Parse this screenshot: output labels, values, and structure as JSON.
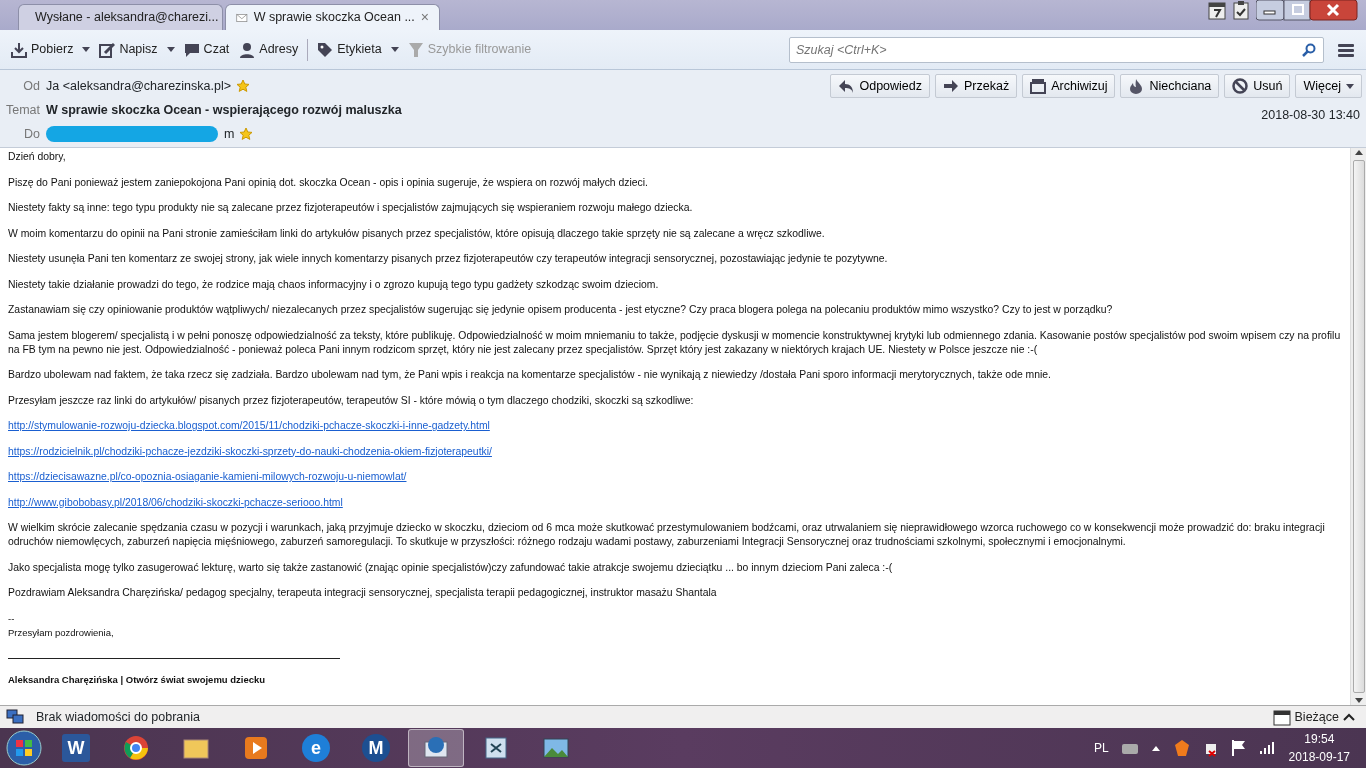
{
  "tabs": [
    {
      "kind": "folder",
      "label": "Wysłane - aleksandra@charezi...",
      "selected": false
    },
    {
      "kind": "message",
      "label": "W sprawie skoczka Ocean ...",
      "selected": true,
      "close": "×"
    }
  ],
  "toolbar": {
    "buttons": [
      {
        "kind": "download",
        "label": "Pobierz",
        "dropdown": true,
        "disabled": false
      },
      {
        "kind": "write",
        "label": "Napisz",
        "dropdown": true,
        "disabled": false
      },
      {
        "kind": "chat",
        "label": "Czat",
        "dropdown": false,
        "disabled": false
      },
      {
        "kind": "contacts",
        "label": "Adresy",
        "dropdown": false,
        "disabled": false
      },
      {
        "kind": "tag",
        "label": "Etykieta",
        "dropdown": true,
        "disabled": false
      },
      {
        "kind": "filter",
        "label": "Szybkie filtrowanie",
        "dropdown": false,
        "disabled": true
      }
    ],
    "search": {
      "placeholder": "Szukaj <Ctrl+K>"
    }
  },
  "header": {
    "from": {
      "label": "Od",
      "value": "Ja <aleksandra@charezinska.pl>"
    },
    "subject": {
      "label": "Temat",
      "value": "W sprawie skoczka Ocean - wspierającego rozwój maluszka"
    },
    "to": {
      "label": "Do",
      "value": "m",
      "redacted": true
    },
    "date": "2018-08-30 13:40",
    "actions": [
      {
        "kind": "reply",
        "label": "Odpowiedz",
        "dropdown": false
      },
      {
        "kind": "forward",
        "label": "Przekaż",
        "dropdown": false
      },
      {
        "kind": "archive",
        "label": "Archiwizuj",
        "dropdown": false
      },
      {
        "kind": "junk",
        "label": "Niechciana",
        "dropdown": false
      },
      {
        "kind": "delete",
        "label": "Usuń",
        "dropdown": false
      },
      {
        "kind": "more",
        "label": "Więcej",
        "dropdown": true
      }
    ]
  },
  "body": [
    {
      "kind": "text",
      "text": "Dzień dobry,"
    },
    {
      "kind": "text",
      "text": "Piszę do Pani ponieważ jestem zaniepokojona Pani opinią dot. skoczka Ocean - opis i opinia sugeruje, że wspiera on rozwój małych dzieci."
    },
    {
      "kind": "text",
      "text": "Niestety fakty są inne: tego typu produkty nie są zalecane przez fizjoterapeutów i specjalistów zajmujących się wspieraniem rozwoju małego dziecka."
    },
    {
      "kind": "text",
      "text": "W moim komentarzu do opinii na Pani stronie zamieściłam linki do artykułów pisanych przez specjalistów, które opisują dlaczego takie sprzęty nie są zalecane a wręcz szkodliwe."
    },
    {
      "kind": "text",
      "text": "Niestety usunęła Pani ten komentarz ze swojej strony, jak wiele innych komentarzy pisanych przez fizjoterapeutów czy terapeutów integracji sensorycznej, pozostawiając jedynie te pozytywne."
    },
    {
      "kind": "text",
      "text": "Niestety takie działanie prowadzi do tego, że rodzice mają chaos informacyjny i o zgrozo kupują tego typu gadżety szkodząc swoim dzieciom."
    },
    {
      "kind": "text",
      "text": "Zastanawiam się czy opiniowanie produktów wątpliwych/ niezalecanych przez specjalistów sugerując się jedynie opisem producenta - jest etyczne? Czy praca blogera polega na polecaniu produktów mimo wszystko? Czy to jest w porządku?"
    },
    {
      "kind": "text",
      "text": "Sama jestem blogerem/ specjalistą i w pełni ponoszę odpowiedzialność za teksty, które publikuję. Odpowiedzialność  w moim mniemaniu to także, podjęcie dyskusji w momencie konstruktywnej krytyki lub odmiennego zdania. Kasowanie postów specjalistów pod swoim wpisem czy na profilu na FB tym na pewno nie jest. Odpowiedzialność - ponieważ poleca Pani innym rodzicom sprzęt, który nie jest zalecany przez specjalistów. Sprzęt który jest zakazany w niektórych krajach UE. Niestety w Polsce jeszcze nie :-("
    },
    {
      "kind": "text",
      "text": "Bardzo ubolewam nad faktem, że taka rzecz się zadziała. Bardzo ubolewam nad tym, że Pani wpis i reakcja na komentarze specjalistów - nie wynikają z niewiedzy /dostała Pani sporo informacji merytorycznych, także ode mnie."
    },
    {
      "kind": "text",
      "text": "Przesyłam jeszcze raz linki do artykułów/ pisanych przez fizjoterapeutów, terapeutów SI - które mówią o tym dlaczego chodziki, skoczki są szkodliwe:"
    },
    {
      "kind": "link",
      "text": "http://stymulowanie-rozwoju-dziecka.blogspot.com/2015/11/chodziki-pchacze-skoczki-i-inne-gadzety.html"
    },
    {
      "kind": "link",
      "text": "https://rodzicielnik.pl/chodziki-pchacze-jezdziki-skoczki-sprzety-do-nauki-chodzenia-okiem-fizjoterapeutki/"
    },
    {
      "kind": "link",
      "text": "https://dziecisawazne.pl/co-opoznia-osiaganie-kamieni-milowych-rozwoju-u-niemowlat/"
    },
    {
      "kind": "link",
      "text": "http://www.gibobobasy.pl/2018/06/chodziki-skoczki-pchacze-seriooo.html"
    },
    {
      "kind": "text",
      "text": "W wielkim skrócie zalecanie spędzania czasu w pozycji i warunkach, jaką przyjmuje dziecko w skoczku, dzieciom od 6 mca może skutkować przestymulowaniem bodźcami, oraz utrwalaniem się nieprawidłowego wzorca ruchowego co w konsekwencji może prowadzić do: braku integracji odruchów niemowlęcych, zaburzeń napięcia mięśniowego, zaburzeń samoregulacji. To skutkuje w przyszłości: różnego rodzaju wadami postawy, zaburzeniami Integracji Sensorycznej oraz trudnościami szkolnymi, społecznymi i emocjonalnymi."
    },
    {
      "kind": "text",
      "text": "Jako specjalista mogę tylko zasugerować lekturę, warto się także zastanowić  (znając opinie specjalistów)czy zafundować takie atrakcje swojemu dzieciątku ... bo innym dzieciom Pani zaleca :-("
    },
    {
      "kind": "text",
      "text": "Pozdrawiam Aleksandra Charęzińska/ pedagog specjalny, terapeuta integracji sensorycznej, specjalista terapii pedagogicznej, instruktor masażu Shantala"
    },
    {
      "kind": "small",
      "text": "--"
    },
    {
      "kind": "small",
      "text": "Przesyłam pozdrowienia,"
    },
    {
      "kind": "rule"
    },
    {
      "kind": "signature",
      "text": "Aleksandra Charęzińska | Otwórz świat swojemu dziecku"
    }
  ],
  "status_bar": {
    "text": "Brak wiadomości do pobrania",
    "calendar": "Bieżące"
  },
  "taskbar": {
    "apps": [
      {
        "kind": "word",
        "glyph": "W",
        "active": false
      },
      {
        "kind": "chrome",
        "active": false
      },
      {
        "kind": "folder",
        "active": false
      },
      {
        "kind": "media",
        "active": false
      },
      {
        "kind": "ie",
        "glyph": "e",
        "active": false
      },
      {
        "kind": "letter",
        "glyph": "M",
        "active": false
      },
      {
        "kind": "mail",
        "active": true
      },
      {
        "kind": "app",
        "active": false
      },
      {
        "kind": "picture",
        "active": false
      }
    ],
    "language": "PL",
    "time": "19:54",
    "date": "2018-09-17"
  }
}
